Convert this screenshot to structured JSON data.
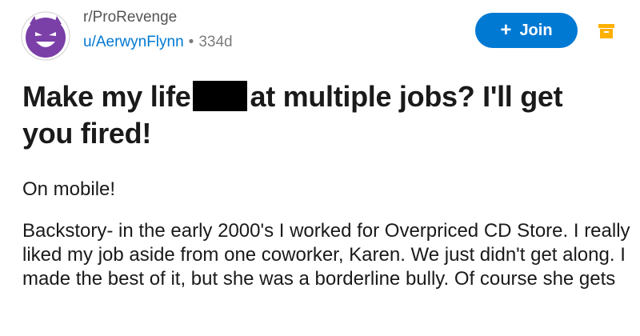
{
  "post": {
    "subreddit": "r/ProRevenge",
    "author": "u/AerwynFlynn",
    "separator": "•",
    "age": "334d",
    "join_label": "Join",
    "join_icon": "+",
    "title_before": "Make my life",
    "title_after": "at multiple jobs? I'll get you fired!",
    "body": [
      "On mobile!",
      "Backstory- in the early 2000's I worked for Overpriced CD Store. I really liked my job aside from one coworker, Karen. We just didn't get along. I made the best of it, but she was a borderline bully. Of course she gets"
    ]
  },
  "colors": {
    "accent": "#0079d3",
    "avatar_bg": "#6b3fa0",
    "save_icon": "#ffb000",
    "text": "#1a1a1b",
    "muted": "#7c7c7c"
  },
  "icons": {
    "avatar": "devil-face-icon",
    "join": "plus-icon",
    "save": "archive-box-icon"
  }
}
